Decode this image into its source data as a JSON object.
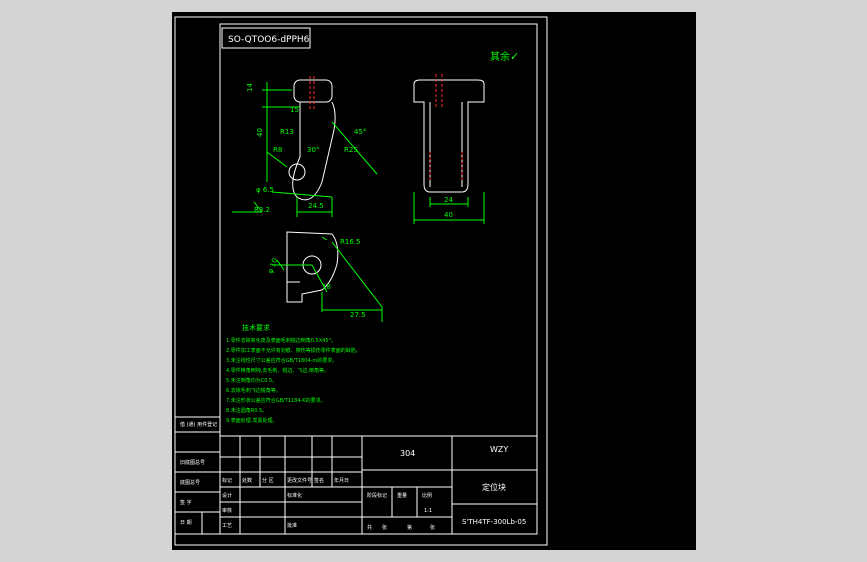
{
  "drawing": {
    "part_code_top": "SO-QTOO6-dPPH6",
    "roughness_note": "其余",
    "roughness_symbol": "✓",
    "material": "304",
    "part_name": "定位块",
    "drawing_number": "S'TH4TF-300Lb-05",
    "company": "WZY",
    "scale": "1:1"
  },
  "views": {
    "side_view_dims": [
      "14",
      "15",
      "40",
      "R13",
      "R8",
      "30°",
      "45°",
      "R25",
      "φ 6.5",
      "24.5",
      "R3.2"
    ],
    "front_view_dims": [
      "24",
      "40"
    ],
    "section_view_dims": [
      "R16.5",
      "φ 10",
      "18",
      "27.5"
    ],
    "right_views_dims": [
      "6.5",
      "6.5",
      "C.W12MW",
      "300-0"
    ]
  },
  "tech_req": {
    "title": "技术要求",
    "lines": [
      "1.零件去除氧化皮及表面毛刺锐边倒角0.5X45°。",
      "2.零件加工表面不允许有划痕、擦伤等损伤零件表面的缺陷。",
      "3.未注线性尺寸公差应符合GB/T1804-m的要求。",
      "4.零件棱角倒钝,去毛刺、锐边、飞边,倒角等。",
      "5.未注倒角均为C0.5。",
      "6.去除毛刺飞边锐角等。",
      "7.未注形状公差应符合GB/T1184-K的要求。",
      "8.未注圆角R0.5。",
      "9.表面处理:发黑处理。"
    ]
  },
  "left_strip": {
    "rows": [
      "借 (通) 用件登记",
      "旧底图总号",
      "底图总号",
      "签 字",
      "日 期"
    ]
  },
  "title_block": {
    "labels": [
      "标记",
      "处数",
      "分 区",
      "更改文件号",
      "签名",
      "年月日",
      "设计",
      "标准化",
      "阶段标记",
      "重量",
      "比例",
      "审核",
      "工艺",
      "批准",
      "共",
      "张",
      "第",
      "张"
    ]
  }
}
